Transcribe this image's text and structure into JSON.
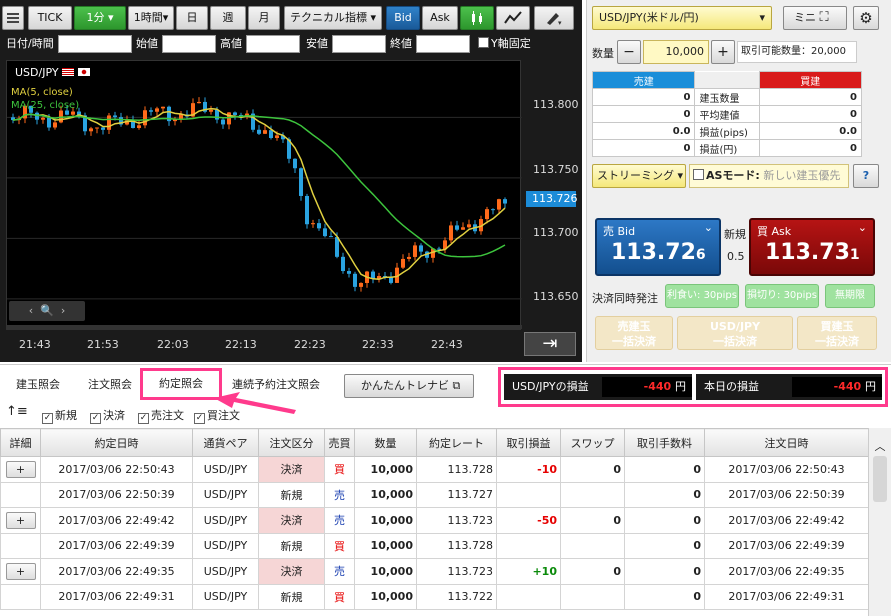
{
  "toolbar": {
    "tick": "TICK",
    "interval": "1分",
    "hour": "1時間",
    "day": "日",
    "week": "週",
    "month": "月",
    "technical": "テクニカル指標",
    "bid": "Bid",
    "ask": "Ask"
  },
  "ohlc": {
    "datetime": "日付/時間",
    "open": "始値",
    "high": "高値",
    "low": "安値",
    "close": "終値",
    "yaxis_fixed": "Y軸固定"
  },
  "chart": {
    "symbol": "USD/JPY",
    "ma5": "MA(5, close)",
    "ma25": "MA(25, close)",
    "prices": [
      "113.800",
      "113.750",
      "113.726",
      "113.700",
      "113.650"
    ],
    "times": [
      "21:43",
      "21:53",
      "22:03",
      "22:13",
      "22:23",
      "22:33",
      "22:43"
    ],
    "current_price": "113.726"
  },
  "chart_data": {
    "type": "candlestick",
    "x": [
      "21:43",
      "21:53",
      "22:03",
      "22:13",
      "22:23",
      "22:33",
      "22:43"
    ],
    "ylim": [
      113.64,
      113.83
    ],
    "series": [
      {
        "name": "MA(5, close)",
        "color": "#e0d040"
      },
      {
        "name": "MA(25, close)",
        "color": "#3dc43d"
      }
    ],
    "last": 113.726
  },
  "order": {
    "pair": "USD/JPY(米ドル/円)",
    "mini": "ミニ",
    "qty_label": "数量",
    "qty": "10,000",
    "max_qty": "取引可能数量：20,000",
    "sell_header": "売建",
    "buy_header": "買建",
    "rows": [
      {
        "left": "0",
        "label": "建玉数量",
        "right": "0"
      },
      {
        "left": "0",
        "label": "平均建値",
        "right": "0"
      },
      {
        "left": "0.0",
        "label": "損益(pips)",
        "right": "0.0"
      },
      {
        "left": "0",
        "label": "損益(円)",
        "right": "0"
      }
    ],
    "streaming": "ストリーミング",
    "as_mode": "ASモード:",
    "as_mode_value": "新しい建玉優先",
    "help": "?",
    "bid_label": "売 Bid",
    "bid_main": "113.72",
    "bid_small": "6",
    "ask_label": "買 Ask",
    "ask_main": "113.73",
    "ask_small": "1",
    "new_label": "新規",
    "spread": "0.5",
    "settle_label": "決済同時発注",
    "take_profit": "利食い: 30pips",
    "stop_loss": "損切り: 30pips",
    "unlimited": "無期限",
    "close_sell_1": "売建玉",
    "close_sell_2": "一括決済",
    "close_all_1": "USD/JPY",
    "close_all_2": "一括決済",
    "close_buy_1": "買建玉",
    "close_buy_2": "一括決済"
  },
  "tabs": [
    "建玉照会",
    "注文照会",
    "約定照会",
    "連続予約注文照会"
  ],
  "easy_button": "かんたんトレナビ",
  "summary": {
    "pair_label": "USD/JPYの損益",
    "pair_value": "-440",
    "yen": "円",
    "day_label": "本日の損益",
    "day_value": "-440"
  },
  "filters": [
    "新規",
    "決済",
    "売注文",
    "買注文"
  ],
  "grid": {
    "headers": [
      "詳細",
      "約定日時",
      "通貨ペア",
      "注文区分",
      "売買",
      "数量",
      "約定レート",
      "取引損益",
      "スワップ",
      "取引手数料",
      "注文日時"
    ],
    "rows": [
      {
        "detail": "+",
        "time": "2017/03/06 22:50:43",
        "pair": "USD/JPY",
        "type": "決済",
        "side": "買",
        "qty": "10,000",
        "rate": "113.728",
        "pl": "-10",
        "swap": "0",
        "fee": "0",
        "order_time": "2017/03/06 22:50:43"
      },
      {
        "detail": "",
        "time": "2017/03/06 22:50:39",
        "pair": "USD/JPY",
        "type": "新規",
        "side": "売",
        "qty": "10,000",
        "rate": "113.727",
        "pl": "",
        "swap": "",
        "fee": "0",
        "order_time": "2017/03/06 22:50:39"
      },
      {
        "detail": "+",
        "time": "2017/03/06 22:49:42",
        "pair": "USD/JPY",
        "type": "決済",
        "side": "売",
        "qty": "10,000",
        "rate": "113.723",
        "pl": "-50",
        "swap": "0",
        "fee": "0",
        "order_time": "2017/03/06 22:49:42"
      },
      {
        "detail": "",
        "time": "2017/03/06 22:49:39",
        "pair": "USD/JPY",
        "type": "新規",
        "side": "買",
        "qty": "10,000",
        "rate": "113.728",
        "pl": "",
        "swap": "",
        "fee": "0",
        "order_time": "2017/03/06 22:49:39"
      },
      {
        "detail": "+",
        "time": "2017/03/06 22:49:35",
        "pair": "USD/JPY",
        "type": "決済",
        "side": "売",
        "qty": "10,000",
        "rate": "113.723",
        "pl": "+10",
        "swap": "0",
        "fee": "0",
        "order_time": "2017/03/06 22:49:35"
      },
      {
        "detail": "",
        "time": "2017/03/06 22:49:31",
        "pair": "USD/JPY",
        "type": "新規",
        "side": "買",
        "qty": "10,000",
        "rate": "113.722",
        "pl": "",
        "swap": "",
        "fee": "0",
        "order_time": "2017/03/06 22:49:31"
      }
    ]
  },
  "colors": {
    "bid": "#1a5fae",
    "ask": "#a80e0e",
    "highlight": "#ff3a8c",
    "up": "#ff6a1a",
    "down": "#2aa3e0"
  }
}
